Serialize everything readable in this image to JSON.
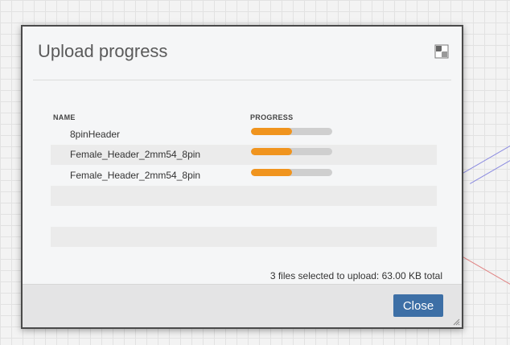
{
  "dialog": {
    "title": "Upload progress",
    "expand_icon": "maximize-icon"
  },
  "columns": {
    "name": "NAME",
    "progress": "PROGRESS"
  },
  "files": [
    {
      "name": "8pinHeader",
      "progress": 0.5
    },
    {
      "name": "Female_Header_2mm54_8pin",
      "progress": 0.5
    },
    {
      "name": "Female_Header_2mm54_8pin",
      "progress": 0.5
    }
  ],
  "summary": "3 files selected to upload: 63.00 KB total",
  "footer": {
    "close_label": "Close"
  },
  "colors": {
    "accent": "#f0941e",
    "button": "#3d6fa6",
    "track": "#cfcfcf"
  }
}
